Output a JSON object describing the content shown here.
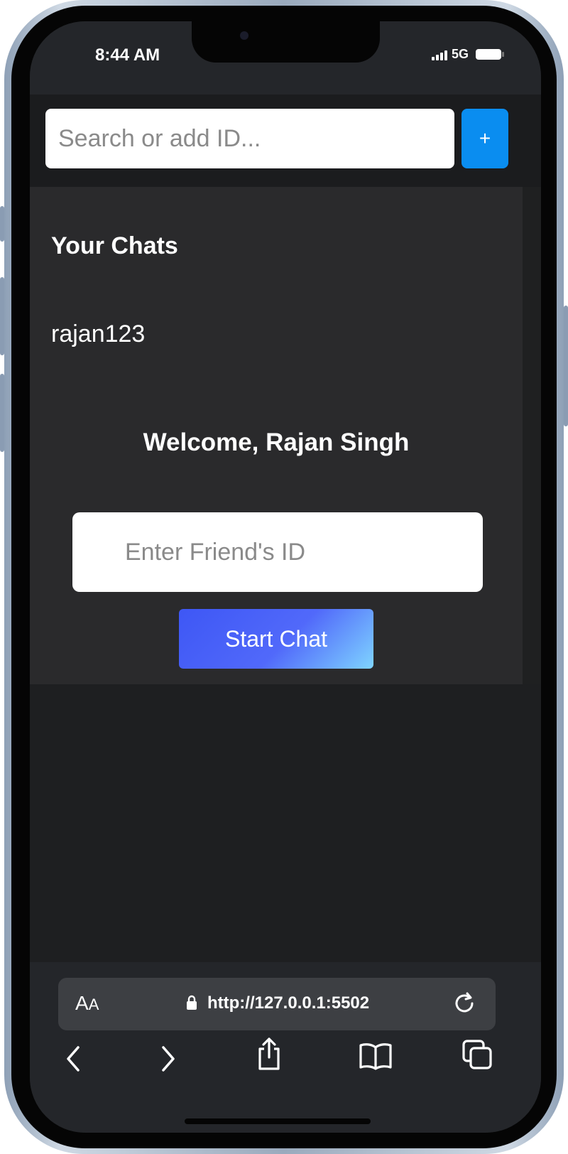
{
  "status_bar": {
    "time": "8:44 AM",
    "network": "5G",
    "icons": [
      "signal-icon",
      "battery-icon"
    ]
  },
  "search": {
    "placeholder": "Search or add ID...",
    "add_label": "+"
  },
  "chats": {
    "title": "Your Chats",
    "items": [
      "rajan123"
    ]
  },
  "welcome": {
    "text": "Welcome, Rajan Singh"
  },
  "friend": {
    "placeholder": "Enter Friend's ID",
    "start_label": "Start Chat"
  },
  "browser": {
    "aa_label": "A",
    "aa_small": "A",
    "url": "http://127.0.0.1:5502",
    "toolbar_icons": [
      "back-icon",
      "forward-icon",
      "share-icon",
      "bookmarks-icon",
      "tabs-icon"
    ]
  },
  "colors": {
    "accent_blue": "#0a8df0",
    "start_gradient_from": "#3e57f5",
    "start_gradient_to": "#7fd4ff",
    "panel_bg": "#2a2a2c",
    "page_bg": "#1e1f21"
  }
}
